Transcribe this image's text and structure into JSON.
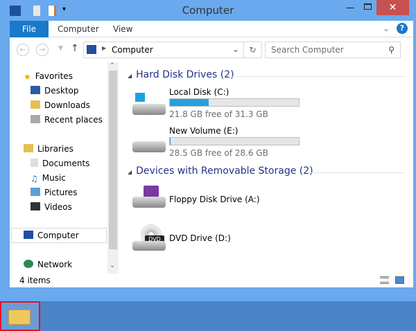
{
  "window": {
    "title": "Computer"
  },
  "ribbon": {
    "tabs": [
      "File",
      "Computer",
      "View"
    ]
  },
  "address": {
    "path": "Computer",
    "search_placeholder": "Search Computer"
  },
  "sidebar": {
    "favorites": {
      "label": "Favorites",
      "items": [
        "Desktop",
        "Downloads",
        "Recent places"
      ]
    },
    "libraries": {
      "label": "Libraries",
      "items": [
        "Documents",
        "Music",
        "Pictures",
        "Videos"
      ]
    },
    "computer": "Computer",
    "network": "Network"
  },
  "groups": [
    {
      "title": "Hard Disk Drives (2)",
      "drives": [
        {
          "name": "Local Disk (C:)",
          "free": "21.8 GB free of 31.3 GB",
          "used_fraction": 0.3
        },
        {
          "name": "New Volume (E:)",
          "free": "28.5 GB free of 28.6 GB",
          "used_fraction": 0.004
        }
      ]
    },
    {
      "title": "Devices with Removable Storage (2)",
      "drives": [
        {
          "name": "Floppy Disk Drive (A:)"
        },
        {
          "name": "DVD Drive (D:)",
          "badge": "DVD"
        }
      ]
    }
  ],
  "status": {
    "items": "4 items"
  },
  "colors": {
    "accent": "#1979ca",
    "bar": "#26a0da",
    "close": "#c75050"
  }
}
